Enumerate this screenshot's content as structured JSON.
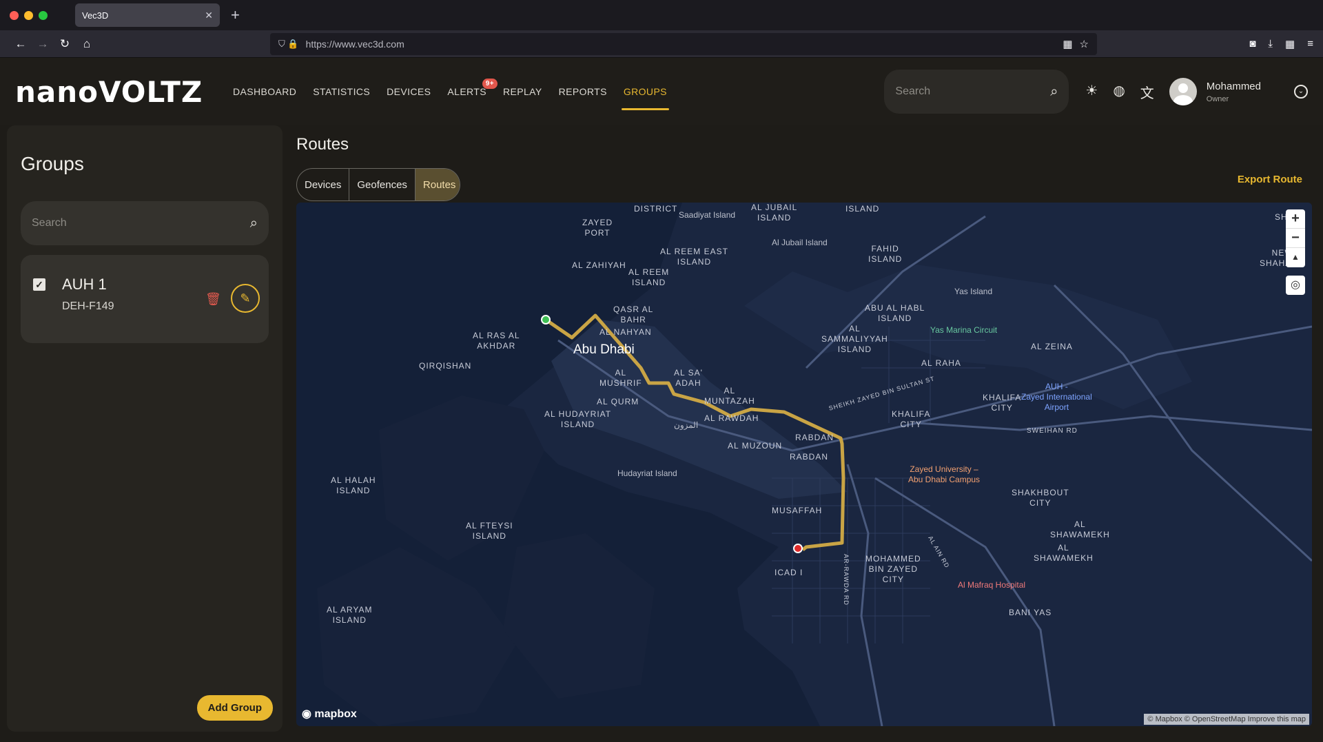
{
  "browser": {
    "tab_title": "Vec3D",
    "url": "https://www.vec3d.com"
  },
  "app": {
    "logo": "nanoVOLTZ",
    "nav": [
      {
        "label": "DASHBOARD"
      },
      {
        "label": "STATISTICS"
      },
      {
        "label": "DEVICES"
      },
      {
        "label": "ALERTS",
        "badge": "9+"
      },
      {
        "label": "REPLAY"
      },
      {
        "label": "REPORTS"
      },
      {
        "label": "GROUPS",
        "active": true
      }
    ],
    "search_placeholder": "Search",
    "user": {
      "name": "Mohammed",
      "role": "Owner"
    }
  },
  "sidebar": {
    "title": "Groups",
    "search_placeholder": "Search",
    "groups": [
      {
        "name": "AUH 1",
        "device": "DEH-F149",
        "checked": true
      }
    ],
    "add_button": "Add Group"
  },
  "content": {
    "title": "Routes",
    "tabs": [
      "Devices",
      "Geofences",
      "Routes"
    ],
    "selected_tab": "Routes",
    "export_label": "Export Route"
  },
  "map": {
    "labels": {
      "district": "DISTRICT",
      "saadiyat": "Saadiyat Island",
      "al_jubail_island": "AL JUBAIL\nISLAND",
      "island": "ISLAND",
      "shah": "SHAH",
      "zayed_port": "ZAYED\nPORT",
      "al_jubail_poi": "Al Jubail Island",
      "fahid": "FAHID\nISLAND",
      "new_shahama": "NEW\nSHAHAMA",
      "al_reem_east": "AL REEM EAST\nISLAND",
      "al_zahiyah": "AL ZAHIYAH",
      "al_reem": "AL REEM\nISLAND",
      "yas_island": "Yas Island",
      "qasr_al_bahr": "QASR AL\nBAHR",
      "abu_al_habl": "ABU AL HABL\nISLAND",
      "al_nahyan": "AL NAHYAN",
      "yas_marina": "Yas Marina Circuit",
      "al_ras_al_akhdar": "AL RAS AL\nAKHDAR",
      "al_sammaliyyah": "AL\nSAMMALIYYAH\nISLAND",
      "al_zeina": "AL ZEINA",
      "abu_dhabi": "Abu Dhabi",
      "qirqishan": "QIRQISHAN",
      "al_raha": "AL RAHA",
      "al_mushrif": "AL\nMUSHRIF",
      "al_sa_adah": "AL SA'\nADAH",
      "auh_airport": "AUH -\nZayed International\nAirport",
      "al_muntazah": "AL\nMUNTAZAH",
      "khalifa_city_top": "KHALIFA\nCITY",
      "al_qurm": "AL QURM",
      "khalifa_city": "KHALIFA\nCITY",
      "al_hudayriat": "AL HUDAYRIAT\nISLAND",
      "al_rawdah": "AL RAWDAH",
      "arabic_label": "المزون",
      "sweihan_rd": "SWEIHAN RD",
      "rabdan": "RABDAN",
      "al_muzoun": "AL MUZOUN",
      "rabdan2": "RABDAN",
      "zayed_univ": "Zayed University –\nAbu Dhabi Campus",
      "hudayriat_poi": "Hudayriat Island",
      "al_halah": "AL HALAH\nISLAND",
      "shakhbout": "SHAKHBOUT\nCITY",
      "musaffah": "MUSAFFAH",
      "al_fteysi": "AL FTEYSI\nISLAND",
      "al_shawamekh": "AL\nSHAWAMEKH",
      "al_shawamekh2": "AL\nSHAWAMEKH",
      "mbz_city": "MOHAMMED\nBIN ZAYED\nCITY",
      "icad": "ICAD I",
      "al_mafraq": "Al Mafraq Hospital",
      "al_aryam": "AL ARYAM\nISLAND",
      "bani_yas": "BANI YAS",
      "sheikh_zayed_st": "SHEIKH ZAYED BIN SULTAN ST",
      "ar_rawda_rd": "AR-RAWDA RD",
      "al_ain_rd": "AL AIN RD"
    },
    "mapbox": "mapbox",
    "attribution": "© Mapbox © OpenStreetMap  Improve this map",
    "route_color": "#c9a445"
  }
}
